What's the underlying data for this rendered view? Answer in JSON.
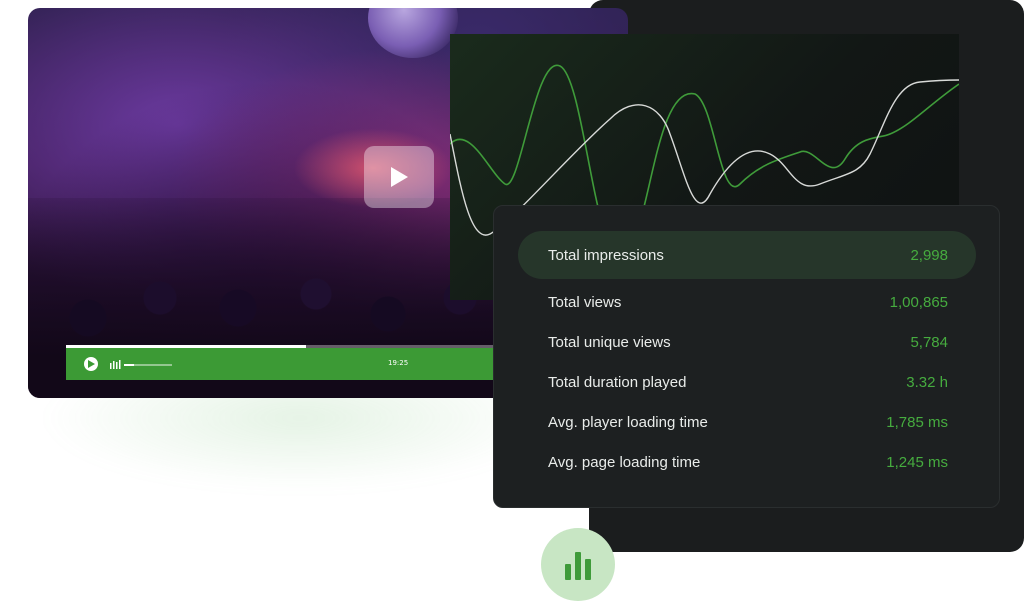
{
  "video": {
    "current_time": "19:25",
    "progress_fraction": 0.51,
    "volume_fraction": 0.2
  },
  "stats": {
    "items": [
      {
        "label": "Total impressions",
        "value": "2,998"
      },
      {
        "label": "Total views",
        "value": "1,00,865"
      },
      {
        "label": "Total unique views",
        "value": "5,784"
      },
      {
        "label": "Total duration played",
        "value": "3.32 h"
      },
      {
        "label": "Avg. player loading time",
        "value": "1,785 ms"
      },
      {
        "label": "Avg. page loading time",
        "value": "1,245 ms"
      }
    ]
  },
  "colors": {
    "accent_green": "#46ac3f",
    "control_bar_green": "#3c9a35",
    "panel_dark": "#1b1d1e",
    "badge_green": "#c8e6c4"
  },
  "icons": {
    "play": "play-icon",
    "volume": "volume-icon",
    "badge": "bar-chart-icon"
  }
}
